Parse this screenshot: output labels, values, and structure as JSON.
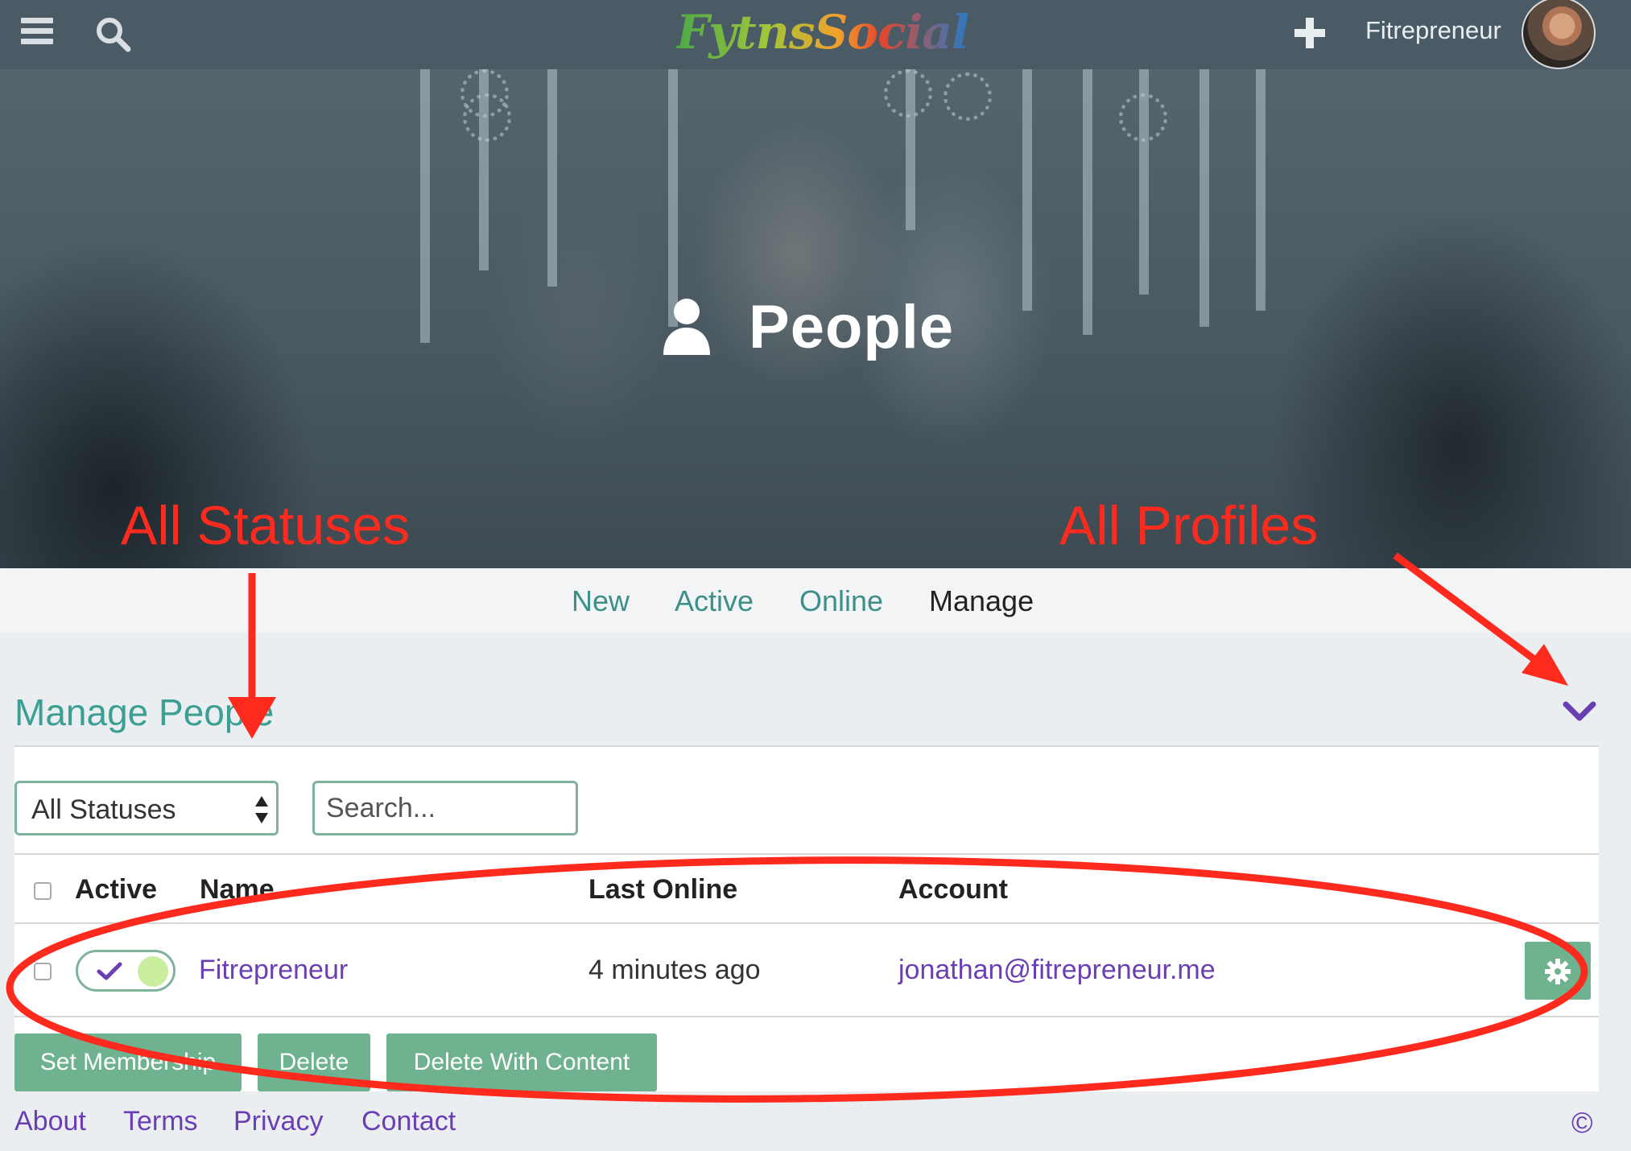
{
  "topbar": {
    "logo_text": "FytnsSocial",
    "user_name": "Fitrepreneur"
  },
  "hero": {
    "title": "People"
  },
  "tabs": [
    {
      "label": "New"
    },
    {
      "label": "Active"
    },
    {
      "label": "Online"
    },
    {
      "label": "Manage",
      "current": true
    }
  ],
  "manage": {
    "title": "Manage People",
    "status_filter": {
      "selected": "All Statuses"
    },
    "search": {
      "placeholder": "Search..."
    },
    "table": {
      "columns": [
        "Active",
        "Name",
        "Last Online",
        "Account"
      ],
      "rows": [
        {
          "active": true,
          "name": "Fitrepreneur",
          "last_online": "4 minutes ago",
          "account": "jonathan@fitrepreneur.me"
        }
      ]
    },
    "actions": {
      "set_membership": "Set Membership",
      "delete": "Delete",
      "delete_with_content": "Delete With Content"
    }
  },
  "footer": {
    "links": [
      "About",
      "Terms",
      "Privacy",
      "Contact"
    ],
    "copyright": "©"
  },
  "annotations": {
    "left_label": "All Statuses",
    "right_label": "All Profiles"
  },
  "colors": {
    "topbar": "#4a5b66",
    "accent_green": "#6fb28f",
    "link_purple": "#6a3fb4",
    "teal_heading": "#3c9f94",
    "annotation_red": "#ff2a1e"
  }
}
